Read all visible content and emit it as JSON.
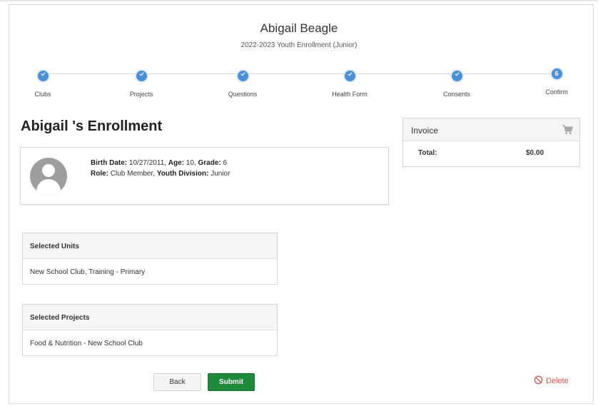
{
  "header": {
    "name": "Abigail Beagle",
    "subtitle": "2022-2023 Youth Enrollment (Junior)"
  },
  "stepper": {
    "steps": [
      {
        "label": "Clubs",
        "state": "complete"
      },
      {
        "label": "Projects",
        "state": "complete"
      },
      {
        "label": "Questions",
        "state": "complete"
      },
      {
        "label": "Health Form",
        "state": "complete"
      },
      {
        "label": "Consents",
        "state": "complete"
      },
      {
        "label": "Confirm",
        "state": "current",
        "number": "6"
      }
    ]
  },
  "enrollment": {
    "title": "Abigail 's Enrollment"
  },
  "profile": {
    "birth_date_label": "Birth Date:",
    "birth_date": "10/27/2011,",
    "age_label": "Age:",
    "age": "10,",
    "grade_label": "Grade:",
    "grade": "6",
    "role_label": "Role:",
    "role": "Club Member,",
    "division_label": "Youth Division:",
    "division": "Junior"
  },
  "invoice": {
    "title": "Invoice",
    "total_label": "Total:",
    "total_value": "$0.00",
    "icon": "cart-icon"
  },
  "units": {
    "heading": "Selected Units",
    "value": "New School Club, Training - Primary"
  },
  "projects": {
    "heading": "Selected Projects",
    "value": "Food & Nutrition - New School Club"
  },
  "actions": {
    "back_label": "Back",
    "submit_label": "Submit",
    "delete_label": "Delete"
  },
  "colors": {
    "step_blue": "#4a90d9",
    "submit_green": "#1e8a3a",
    "delete_red": "#d9534f"
  }
}
